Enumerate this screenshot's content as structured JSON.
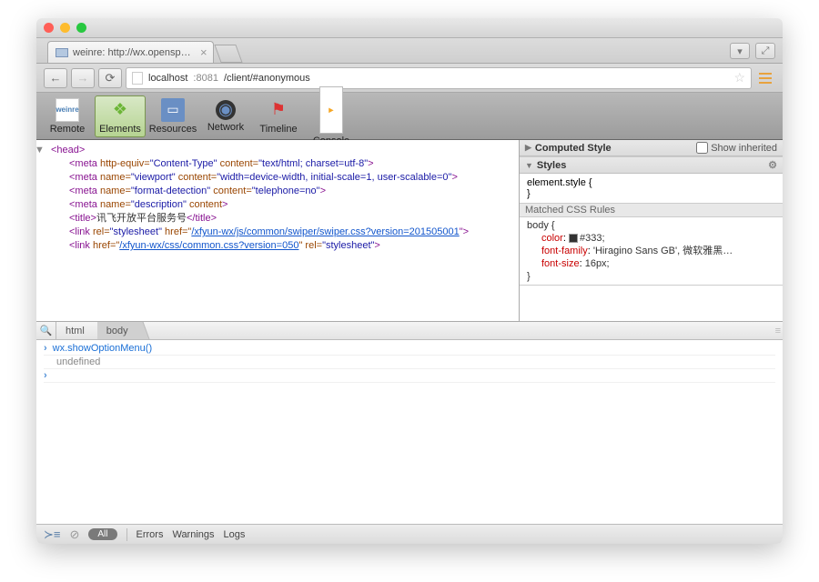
{
  "tab": {
    "title": "weinre: http://wx.opensp…"
  },
  "address": {
    "host": "localhost",
    "port": ":8081",
    "path": "/client/#anonymous"
  },
  "toolbar": {
    "remote": "Remote",
    "elements": "Elements",
    "resources": "Resources",
    "network": "Network",
    "timeline": "Timeline",
    "console": "Console"
  },
  "dom": {
    "l1": "<head>",
    "l2a": "<meta",
    "l2b": " http-equiv=",
    "l2c": "\"Content-Type\"",
    "l2d": " content=",
    "l2e": "\"text/html; charset=utf-8\"",
    "l2f": ">",
    "l3a": "<meta",
    "l3b": " name=",
    "l3c": "\"viewport\"",
    "l3d": " content=",
    "l3e": "\"width=device-width, initial-scale=1, user-scalable=0\"",
    "l3f": ">",
    "l4a": "<meta",
    "l4b": " name=",
    "l4c": "\"format-detection\"",
    "l4d": " content=",
    "l4e": "\"telephone=no\"",
    "l4f": ">",
    "l5a": "<meta",
    "l5b": " name=",
    "l5c": "\"description\"",
    "l5d": " content",
    "l5e": ">",
    "l6a": "<title>",
    "l6b": "讯飞开放平台服务号",
    "l6c": "</title>",
    "l7a": "<link",
    "l7b": " rel=",
    "l7c": "\"stylesheet\"",
    "l7d": " href=\"",
    "l7e": "/xfyun-wx/js/common/swiper/swiper.css?version=201505001",
    "l7f": "\">",
    "l8a": "<link",
    "l8b": " href=\"",
    "l8c": "/xfyun-wx/css/common.css?version=050",
    "l8d": "\" rel=",
    "l8e": "\"stylesheet\"",
    "l8f": ">"
  },
  "bc": {
    "html": "html",
    "body": "body"
  },
  "styles": {
    "computed": "Computed Style",
    "inherited": "Show inherited",
    "styles": "Styles",
    "elstyle": "element.style {",
    "matched": "Matched CSS Rules",
    "bodysel": "body {",
    "color_p": "color",
    "color_v": "#333;",
    "ff_p": "font-family",
    "ff_v": "'Hiragino Sans GB', 微软雅黑…",
    "fs_p": "font-size",
    "fs_v": "16px;",
    "close": "}"
  },
  "consoleData": {
    "call": "wx.showOptionMenu()",
    "result": "undefined"
  },
  "footer": {
    "all": "All",
    "errors": "Errors",
    "warnings": "Warnings",
    "logs": "Logs"
  }
}
